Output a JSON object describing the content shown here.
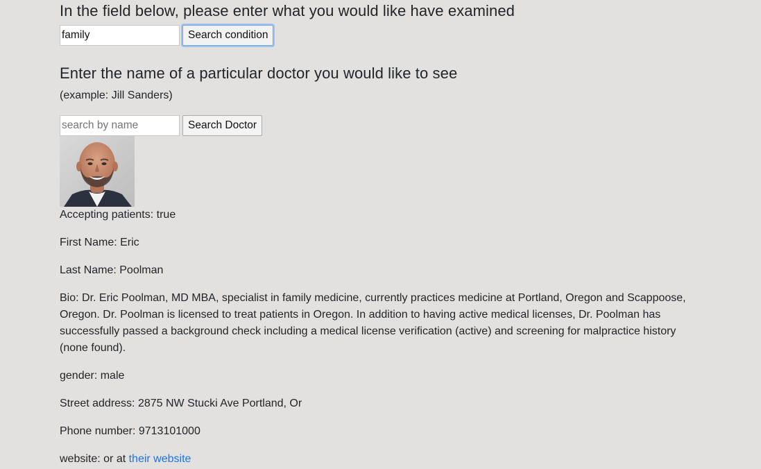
{
  "condition_search": {
    "heading": "In the field below, please enter what you would like have examined",
    "input_value": "family",
    "button_label": "Search condition"
  },
  "doctor_search": {
    "heading": "Enter the name of a particular doctor you would like to see",
    "example": "(example: Jill Sanders)",
    "input_placeholder": "search by name",
    "button_label": "Search Doctor"
  },
  "doctor": {
    "photo_icon": "doctor-portrait",
    "accepting": "Accepting patients: true",
    "first_name": "First Name: Eric",
    "last_name": "Last Name: Poolman",
    "bio": "Bio: Dr. Eric Poolman, MD MBA, specialist in family medicine, currently practices medicine at Portland, Oregon and Scappoose, Oregon. Dr. Poolman is licensed to treat patients in Oregon. In addition to having active medical licenses, Dr. Poolman has successfully passed a background check including a medical license verification (active) and screening for malpractice history (none found).",
    "gender": "gender: male",
    "street": "Street address: 2875 NW Stucki Ave Portland, Or",
    "phone": "Phone number: 9713101000",
    "website_prefix": "website: or at ",
    "website_link": "their website"
  },
  "colors": {
    "background": "#e2e1e0",
    "link": "#1a73e8",
    "focus_ring": "#9cc2f0"
  }
}
